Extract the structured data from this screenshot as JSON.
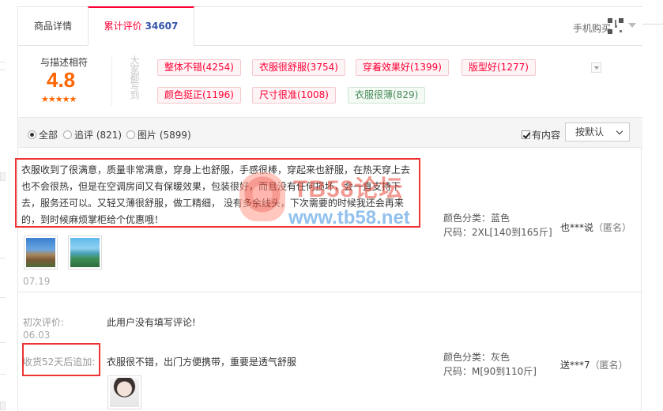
{
  "tabs": {
    "detail": "商品详情",
    "reviews": "累计评价",
    "reviews_count": "34607",
    "mobile_buy": "手机购买"
  },
  "summary": {
    "score_label": "与描述相符",
    "score": "4.8",
    "stars": "★★★★★",
    "tags_label": "大家都写到",
    "tags": [
      {
        "label": "整体不错(4254)",
        "kind": "positive"
      },
      {
        "label": "衣服很舒服(3754)",
        "kind": "positive"
      },
      {
        "label": "穿着效果好(1399)",
        "kind": "positive"
      },
      {
        "label": "版型好(1277)",
        "kind": "positive"
      },
      {
        "label": "颜色挺正(1196)",
        "kind": "positive"
      },
      {
        "label": "尺寸很准(1008)",
        "kind": "positive"
      },
      {
        "label": "衣服很薄(829)",
        "kind": "neutral"
      }
    ]
  },
  "filters": {
    "all": "全部",
    "followup": "追评 (821)",
    "images": "图片 (5899)",
    "has_content": "有内容",
    "sort": "按默认"
  },
  "review1": {
    "text": "衣服收到了很满意，质量非常满意，穿身上也舒服，手感很棒，穿起来也舒服，在热天穿上去也不会很热，但是在空调房间又有保暖效果，包装很好，而且没有任何损坏，会一直支持下去，服务还可以。又轻又薄很舒服，做工精细， 没有多余线头，下次需要的时候我还会再来的，到时候麻烦掌柜给个优惠哦！",
    "date": "07.19",
    "color": "颜色分类：蓝色",
    "size": "尺码：2XL[140到165斤]",
    "user": "也***说",
    "anon": "（匿名）"
  },
  "review2": {
    "initial_label": "初次评价:",
    "initial_text": "此用户没有填写评论!",
    "initial_date": "06.03",
    "followup_label": "收货52天后追加:",
    "followup_text": "衣服很不错，出门方便携带，重要是透气舒服",
    "color": "颜色分类：灰色",
    "size": "尺码：M[90到110斤]",
    "user": "送***7",
    "anon": "（匿名）"
  },
  "watermark": {
    "title": "TB58论坛",
    "url": "www.tb58.net"
  },
  "colors": {
    "accent": "#ff0036",
    "score": "#ff6500",
    "highlight_box": "#e33333",
    "count_blue": "#3355aa"
  }
}
